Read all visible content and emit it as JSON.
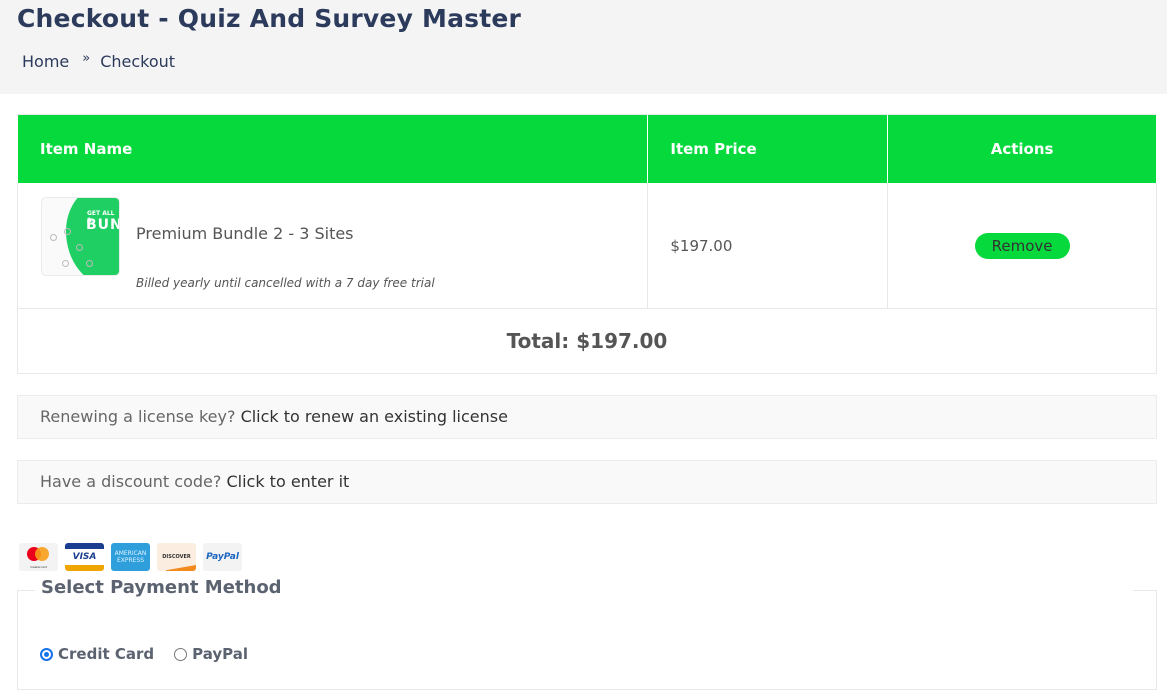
{
  "header": {
    "title": "Checkout - Quiz And Survey Master",
    "breadcrumb": [
      "Home",
      "»",
      "Checkout"
    ]
  },
  "cart": {
    "columns": [
      "Item Name",
      "Item Price",
      "Actions"
    ],
    "items": [
      {
        "thumbnail_text_1": "GET ALL A",
        "thumbnail_text_2": "BUN",
        "name": "Premium Bundle 2 - 3 Sites",
        "note": "Billed yearly until cancelled with a 7 day free trial",
        "price": "$197.00",
        "action_label": "Remove"
      }
    ],
    "total_label": "Total: $197.00"
  },
  "notices": {
    "renew_prefix": "Renewing a license key? ",
    "renew_link": "Click to renew an existing license",
    "discount_prefix": "Have a discount code? ",
    "discount_link": "Click to enter it"
  },
  "card_icons": [
    {
      "name": "mastercard",
      "label": "mastercard"
    },
    {
      "name": "visa",
      "label": "VISA"
    },
    {
      "name": "amex",
      "label": "AMERICAN EXPRESS"
    },
    {
      "name": "discover",
      "label": "DISCOVER"
    },
    {
      "name": "paypal",
      "label": "PayPal"
    }
  ],
  "payment": {
    "legend": "Select Payment Method",
    "options": [
      {
        "label": "Credit Card",
        "selected": true
      },
      {
        "label": "PayPal",
        "selected": false
      }
    ]
  },
  "colors": {
    "accent_green": "#06d93c",
    "title_navy": "#2c3a5c",
    "radio_blue": "#1672e8"
  }
}
